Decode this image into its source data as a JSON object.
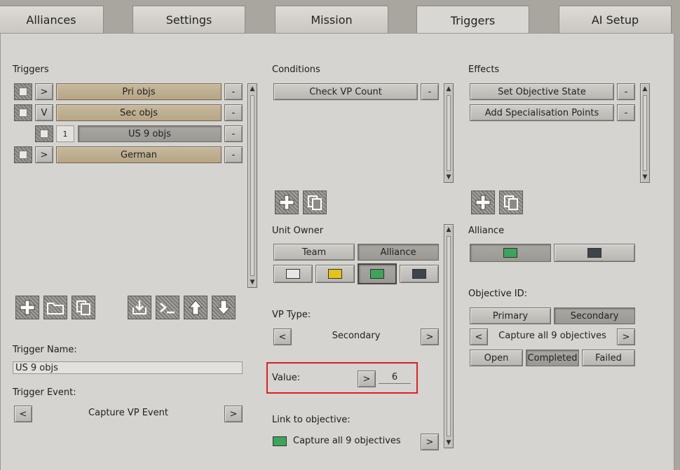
{
  "tabs": [
    {
      "label": "Alliances"
    },
    {
      "label": "Settings"
    },
    {
      "label": "Mission"
    },
    {
      "label": "Triggers"
    },
    {
      "label": "AI Setup"
    }
  ],
  "triggers": {
    "heading": "Triggers",
    "items": [
      {
        "expander": ">",
        "label": "Pri objs",
        "remove": "-"
      },
      {
        "expander": "V",
        "label": "Sec objs",
        "remove": "-"
      },
      {
        "index": "1",
        "label": "US 9 objs",
        "remove": "-"
      },
      {
        "expander": ">",
        "label": "German",
        "remove": "-"
      }
    ],
    "name_label": "Trigger Name:",
    "name_value": "US 9 objs",
    "event_label": "Trigger Event:",
    "event_prev": "<",
    "event_value": "Capture VP Event",
    "event_next": ">"
  },
  "conditions": {
    "heading": "Conditions",
    "items": [
      {
        "label": "Check VP Count",
        "remove": "-"
      }
    ],
    "unit_owner_label": "Unit Owner",
    "team_label": "Team",
    "alliance_label": "Alliance",
    "owner_colors": [
      "#e6e6e6",
      "#e6c417",
      "#3ea35b",
      "#3d444c"
    ],
    "vp_type_label": "VP Type:",
    "vp_prev": "<",
    "vp_value": "Secondary",
    "vp_next": ">",
    "value_label": "Value:",
    "value_arrow": ">",
    "value": "6",
    "link_label": "Link to objective:",
    "link_color": "#3ea35b",
    "link_value": "Capture all 9 objectives",
    "link_arrow": ">"
  },
  "effects": {
    "heading": "Effects",
    "items": [
      {
        "label": "Set Objective State",
        "remove": "-"
      },
      {
        "label": "Add Specialisation Points",
        "remove": "-"
      }
    ],
    "alliance_label": "Alliance",
    "alliance_colors": [
      "#3ea35b",
      "#3d444c"
    ],
    "objective_id_label": "Objective ID:",
    "primary_label": "Primary",
    "secondary_label": "Secondary",
    "obj_prev": "<",
    "obj_value": "Capture all 9 objectives",
    "obj_next": ">",
    "open_label": "Open",
    "completed_label": "Completed",
    "failed_label": "Failed"
  },
  "highlight_color": "#e02020"
}
